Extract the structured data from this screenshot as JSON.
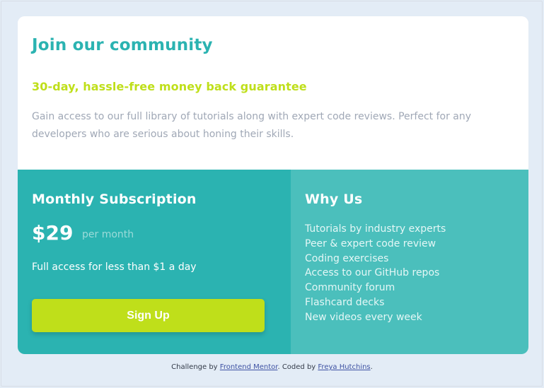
{
  "header": {
    "title": "Join our community",
    "guarantee": "30-day, hassle-free money back guarantee",
    "description": "Gain access to our full library of tutorials along with expert code reviews. Perfect for any developers who are serious about honing their skills."
  },
  "subscription": {
    "title": "Monthly Subscription",
    "price": "$29",
    "period": "per month",
    "note": "Full access for less than $1 a day",
    "button_label": "Sign Up"
  },
  "why": {
    "title": "Why Us",
    "items": [
      "Tutorials by industry experts",
      "Peer & expert code review",
      "Coding exercises",
      "Access to our GitHub repos",
      "Community forum",
      "Flashcard decks",
      "New videos every week"
    ]
  },
  "attribution": {
    "prefix": "Challenge by",
    "link1": "Frontend Mentor",
    "middle": ". Coded by",
    "link2": "Freya Hutchins",
    "suffix": "."
  },
  "colors": {
    "background": "#e3ecf6",
    "primary": "#2bb3b1",
    "secondary": "#4bbfbc",
    "accent": "#bfdf1a",
    "text_muted": "#a0a8b6"
  }
}
